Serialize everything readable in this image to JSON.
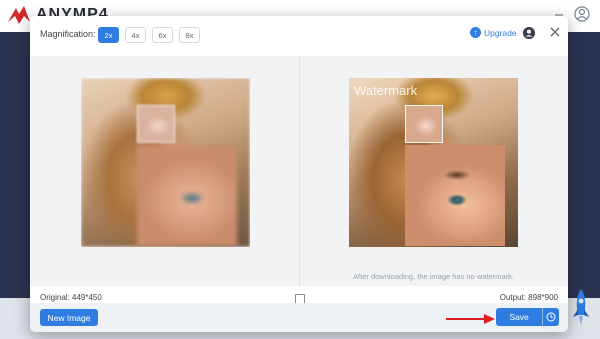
{
  "app": {
    "logo_text": "ANYMP4"
  },
  "header": {
    "magnification_label": "Magnification:",
    "mag_options": [
      "2x",
      "4x",
      "6x",
      "8x"
    ],
    "selected": "2x",
    "upgrade_label": "Upgrade"
  },
  "preview": {
    "watermark_text": "Watermark",
    "no_watermark_note": "After downloading, the image has no watermark."
  },
  "info": {
    "original_size": "Original: 449*450",
    "output_size": "Output: 898*900"
  },
  "footer": {
    "new_image_label": "New Image",
    "save_label": "Save"
  },
  "colors": {
    "accent": "#2f7de1",
    "arrow": "#e02020"
  }
}
